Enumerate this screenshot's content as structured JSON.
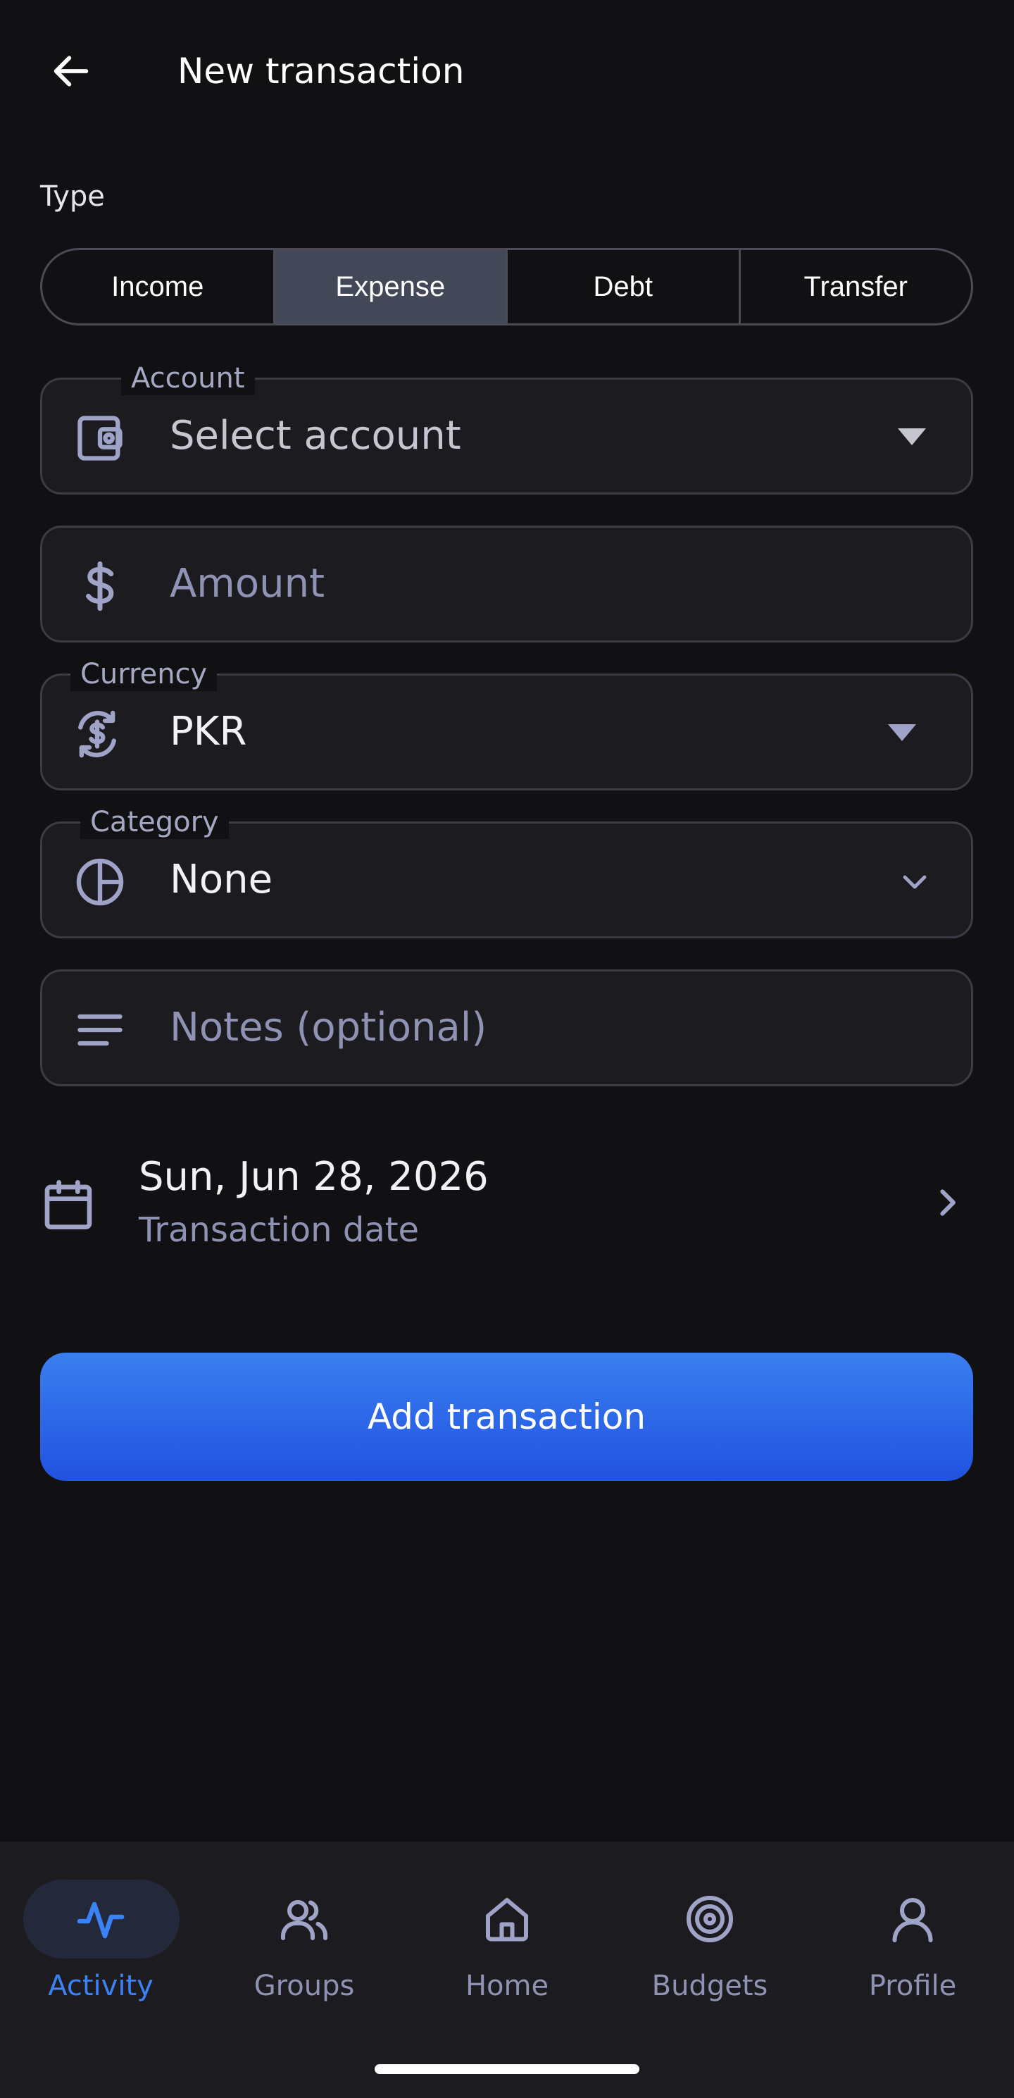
{
  "header": {
    "title": "New transaction"
  },
  "type_section": {
    "label": "Type",
    "options": [
      "Income",
      "Expense",
      "Debt",
      "Transfer"
    ],
    "selected": "Expense"
  },
  "account": {
    "label": "Account",
    "placeholder": "Select account"
  },
  "amount": {
    "placeholder": "Amount"
  },
  "currency": {
    "label": "Currency",
    "value": "PKR"
  },
  "category": {
    "label": "Category",
    "value": "None"
  },
  "notes": {
    "placeholder": "Notes (optional)"
  },
  "date": {
    "value": "Sun, Jun 28, 2026",
    "label": "Transaction date"
  },
  "submit": {
    "label": "Add transaction"
  },
  "nav": {
    "items": [
      {
        "label": "Activity",
        "icon": "activity-icon",
        "active": true
      },
      {
        "label": "Groups",
        "icon": "groups-icon",
        "active": false
      },
      {
        "label": "Home",
        "icon": "home-icon",
        "active": false
      },
      {
        "label": "Budgets",
        "icon": "target-icon",
        "active": false
      },
      {
        "label": "Profile",
        "icon": "profile-icon",
        "active": false
      }
    ]
  },
  "colors": {
    "background": "#111113",
    "surface": "#1c1c20",
    "accent": "#3b82f6",
    "segment_active": "#434859",
    "muted_text": "#8f92b3"
  }
}
